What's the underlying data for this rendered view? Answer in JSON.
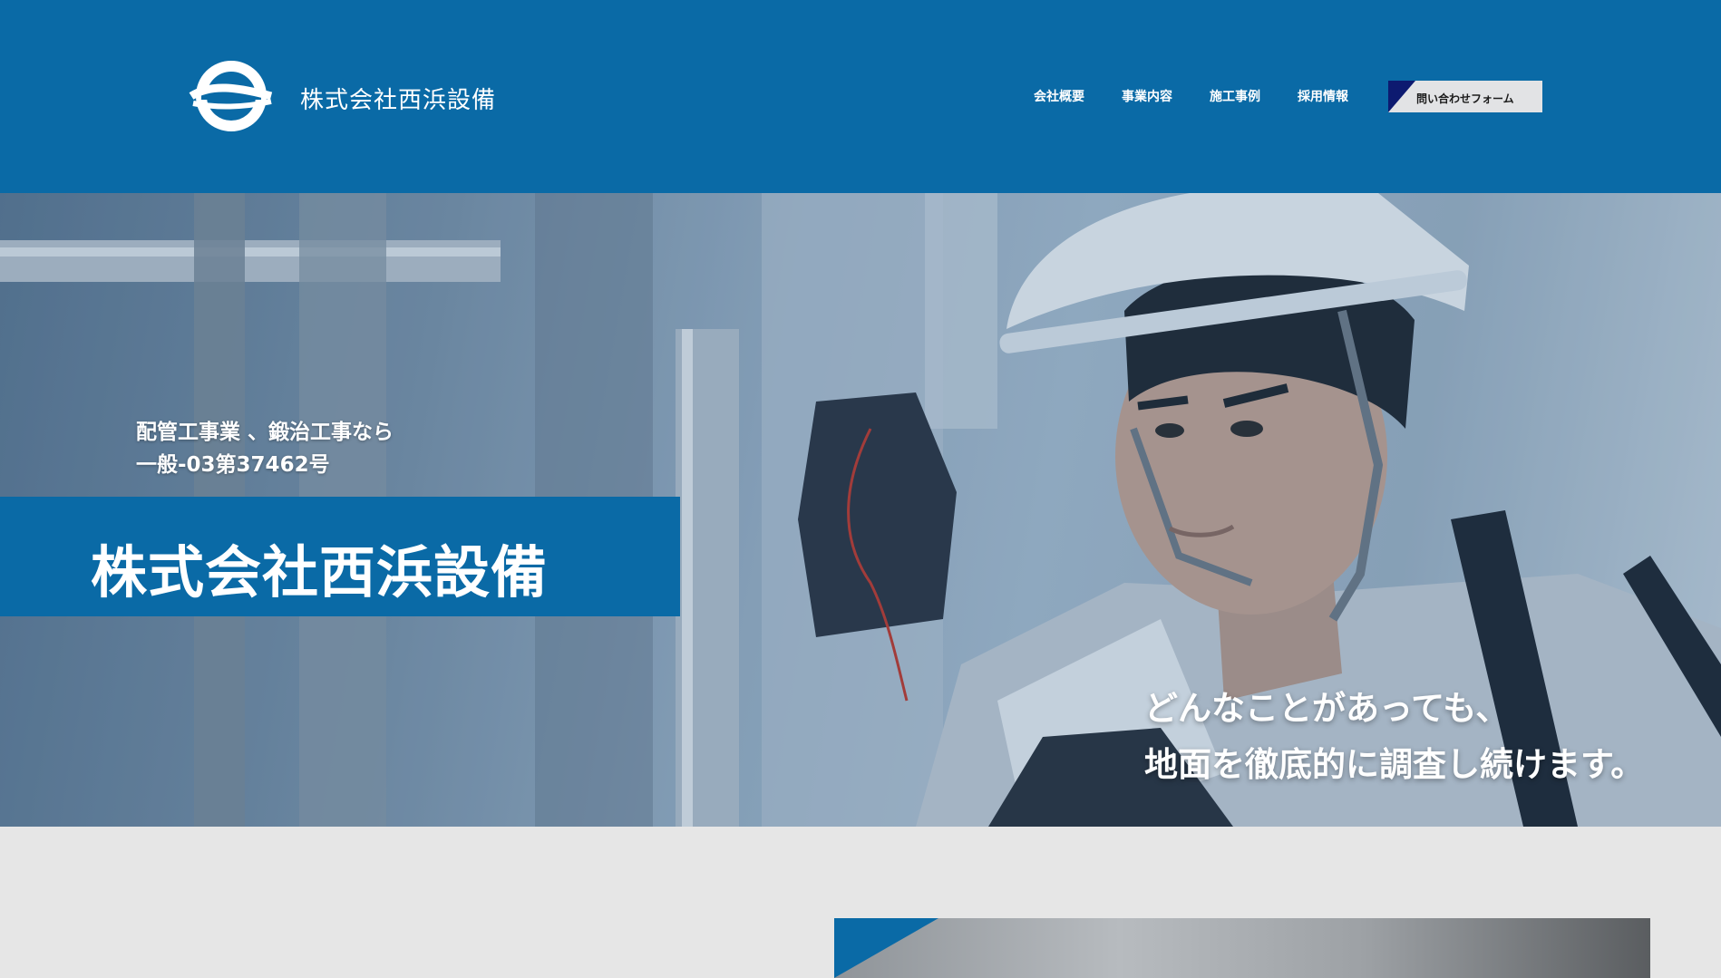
{
  "brand": {
    "name": "株式会社西浜設備",
    "logo_icon": "company-logo-icon",
    "primary_color": "#0a6aa6"
  },
  "nav": {
    "items": [
      {
        "label": "会社概要"
      },
      {
        "label": "事業内容"
      },
      {
        "label": "施工事例"
      },
      {
        "label": "採用情報"
      }
    ],
    "contact_label": "問い合わせフォーム"
  },
  "hero": {
    "tagline_line1": "配管工事業 、鍛治工事なら",
    "tagline_line2": "一般-03第37462号",
    "title": "株式会社西浜設備",
    "catch_line1": "どんなことがあっても、",
    "catch_line2": "地面を徹底的に調査し続けます。"
  }
}
